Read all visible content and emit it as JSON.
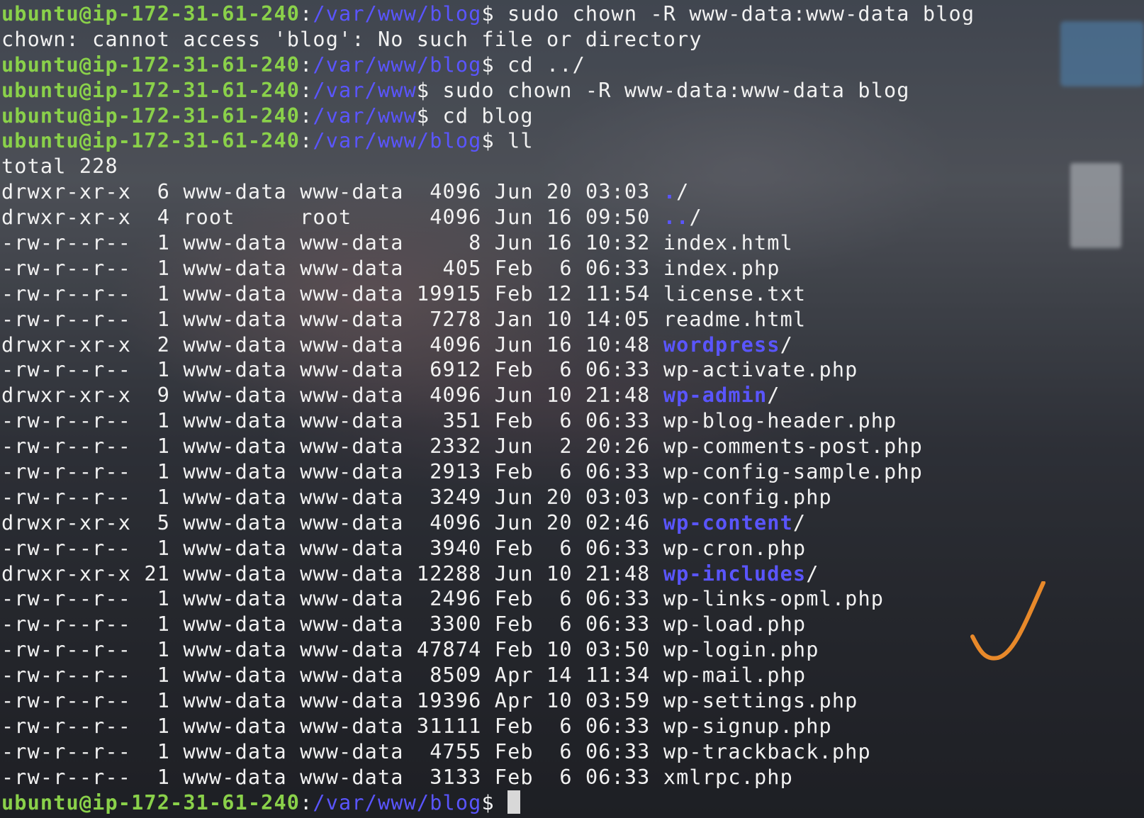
{
  "colors": {
    "prompt_user": "#8ad14a",
    "prompt_path": "#5a55ff",
    "directory": "#5a55ff",
    "text": "#f2f2f2",
    "checkmark": "#e8892a"
  },
  "terminal": {
    "history": [
      {
        "user": "ubuntu@ip-172-31-61-240",
        "sep": ":",
        "path": "/var/www/blog",
        "suffix": "$",
        "command": " sudo chown -R www-data:www-data blog"
      },
      {
        "output": "chown: cannot access 'blog': No such file or directory"
      },
      {
        "user": "ubuntu@ip-172-31-61-240",
        "sep": ":",
        "path": "/var/www/blog",
        "suffix": "$",
        "command": " cd ../"
      },
      {
        "user": "ubuntu@ip-172-31-61-240",
        "sep": ":",
        "path": "/var/www",
        "suffix": "$",
        "command": " sudo chown -R www-data:www-data blog"
      },
      {
        "user": "ubuntu@ip-172-31-61-240",
        "sep": ":",
        "path": "/var/www",
        "suffix": "$",
        "command": " cd blog"
      },
      {
        "user": "ubuntu@ip-172-31-61-240",
        "sep": ":",
        "path": "/var/www/blog",
        "suffix": "$",
        "command": " ll"
      },
      {
        "output": "total 228"
      }
    ],
    "listing": [
      {
        "perms": "drwxr-xr-x",
        "links": "6",
        "owner": "www-data",
        "group": "www-data",
        "size": "4096",
        "month": "Jun",
        "day": "20",
        "time": "03:03",
        "name": ".",
        "is_dir": true
      },
      {
        "perms": "drwxr-xr-x",
        "links": "4",
        "owner": "root",
        "group": "root",
        "size": "4096",
        "month": "Jun",
        "day": "16",
        "time": "09:50",
        "name": "..",
        "is_dir": true
      },
      {
        "perms": "-rw-r--r--",
        "links": "1",
        "owner": "www-data",
        "group": "www-data",
        "size": "8",
        "month": "Jun",
        "day": "16",
        "time": "10:32",
        "name": "index.html",
        "is_dir": false
      },
      {
        "perms": "-rw-r--r--",
        "links": "1",
        "owner": "www-data",
        "group": "www-data",
        "size": "405",
        "month": "Feb",
        "day": "6",
        "time": "06:33",
        "name": "index.php",
        "is_dir": false
      },
      {
        "perms": "-rw-r--r--",
        "links": "1",
        "owner": "www-data",
        "group": "www-data",
        "size": "19915",
        "month": "Feb",
        "day": "12",
        "time": "11:54",
        "name": "license.txt",
        "is_dir": false
      },
      {
        "perms": "-rw-r--r--",
        "links": "1",
        "owner": "www-data",
        "group": "www-data",
        "size": "7278",
        "month": "Jan",
        "day": "10",
        "time": "14:05",
        "name": "readme.html",
        "is_dir": false
      },
      {
        "perms": "drwxr-xr-x",
        "links": "2",
        "owner": "www-data",
        "group": "www-data",
        "size": "4096",
        "month": "Jun",
        "day": "16",
        "time": "10:48",
        "name": "wordpress",
        "is_dir": true
      },
      {
        "perms": "-rw-r--r--",
        "links": "1",
        "owner": "www-data",
        "group": "www-data",
        "size": "6912",
        "month": "Feb",
        "day": "6",
        "time": "06:33",
        "name": "wp-activate.php",
        "is_dir": false
      },
      {
        "perms": "drwxr-xr-x",
        "links": "9",
        "owner": "www-data",
        "group": "www-data",
        "size": "4096",
        "month": "Jun",
        "day": "10",
        "time": "21:48",
        "name": "wp-admin",
        "is_dir": true
      },
      {
        "perms": "-rw-r--r--",
        "links": "1",
        "owner": "www-data",
        "group": "www-data",
        "size": "351",
        "month": "Feb",
        "day": "6",
        "time": "06:33",
        "name": "wp-blog-header.php",
        "is_dir": false
      },
      {
        "perms": "-rw-r--r--",
        "links": "1",
        "owner": "www-data",
        "group": "www-data",
        "size": "2332",
        "month": "Jun",
        "day": "2",
        "time": "20:26",
        "name": "wp-comments-post.php",
        "is_dir": false
      },
      {
        "perms": "-rw-r--r--",
        "links": "1",
        "owner": "www-data",
        "group": "www-data",
        "size": "2913",
        "month": "Feb",
        "day": "6",
        "time": "06:33",
        "name": "wp-config-sample.php",
        "is_dir": false
      },
      {
        "perms": "-rw-r--r--",
        "links": "1",
        "owner": "www-data",
        "group": "www-data",
        "size": "3249",
        "month": "Jun",
        "day": "20",
        "time": "03:03",
        "name": "wp-config.php",
        "is_dir": false
      },
      {
        "perms": "drwxr-xr-x",
        "links": "5",
        "owner": "www-data",
        "group": "www-data",
        "size": "4096",
        "month": "Jun",
        "day": "20",
        "time": "02:46",
        "name": "wp-content",
        "is_dir": true
      },
      {
        "perms": "-rw-r--r--",
        "links": "1",
        "owner": "www-data",
        "group": "www-data",
        "size": "3940",
        "month": "Feb",
        "day": "6",
        "time": "06:33",
        "name": "wp-cron.php",
        "is_dir": false
      },
      {
        "perms": "drwxr-xr-x",
        "links": "21",
        "owner": "www-data",
        "group": "www-data",
        "size": "12288",
        "month": "Jun",
        "day": "10",
        "time": "21:48",
        "name": "wp-includes",
        "is_dir": true
      },
      {
        "perms": "-rw-r--r--",
        "links": "1",
        "owner": "www-data",
        "group": "www-data",
        "size": "2496",
        "month": "Feb",
        "day": "6",
        "time": "06:33",
        "name": "wp-links-opml.php",
        "is_dir": false
      },
      {
        "perms": "-rw-r--r--",
        "links": "1",
        "owner": "www-data",
        "group": "www-data",
        "size": "3300",
        "month": "Feb",
        "day": "6",
        "time": "06:33",
        "name": "wp-load.php",
        "is_dir": false
      },
      {
        "perms": "-rw-r--r--",
        "links": "1",
        "owner": "www-data",
        "group": "www-data",
        "size": "47874",
        "month": "Feb",
        "day": "10",
        "time": "03:50",
        "name": "wp-login.php",
        "is_dir": false
      },
      {
        "perms": "-rw-r--r--",
        "links": "1",
        "owner": "www-data",
        "group": "www-data",
        "size": "8509",
        "month": "Apr",
        "day": "14",
        "time": "11:34",
        "name": "wp-mail.php",
        "is_dir": false
      },
      {
        "perms": "-rw-r--r--",
        "links": "1",
        "owner": "www-data",
        "group": "www-data",
        "size": "19396",
        "month": "Apr",
        "day": "10",
        "time": "03:59",
        "name": "wp-settings.php",
        "is_dir": false
      },
      {
        "perms": "-rw-r--r--",
        "links": "1",
        "owner": "www-data",
        "group": "www-data",
        "size": "31111",
        "month": "Feb",
        "day": "6",
        "time": "06:33",
        "name": "wp-signup.php",
        "is_dir": false
      },
      {
        "perms": "-rw-r--r--",
        "links": "1",
        "owner": "www-data",
        "group": "www-data",
        "size": "4755",
        "month": "Feb",
        "day": "6",
        "time": "06:33",
        "name": "wp-trackback.php",
        "is_dir": false
      },
      {
        "perms": "-rw-r--r--",
        "links": "1",
        "owner": "www-data",
        "group": "www-data",
        "size": "3133",
        "month": "Feb",
        "day": "6",
        "time": "06:33",
        "name": "xmlrpc.php",
        "is_dir": false
      }
    ],
    "current_prompt": {
      "user": "ubuntu@ip-172-31-61-240",
      "sep": ":",
      "path": "/var/www/blog",
      "suffix": "$ "
    }
  },
  "annotation": {
    "icon": "checkmark-icon"
  }
}
